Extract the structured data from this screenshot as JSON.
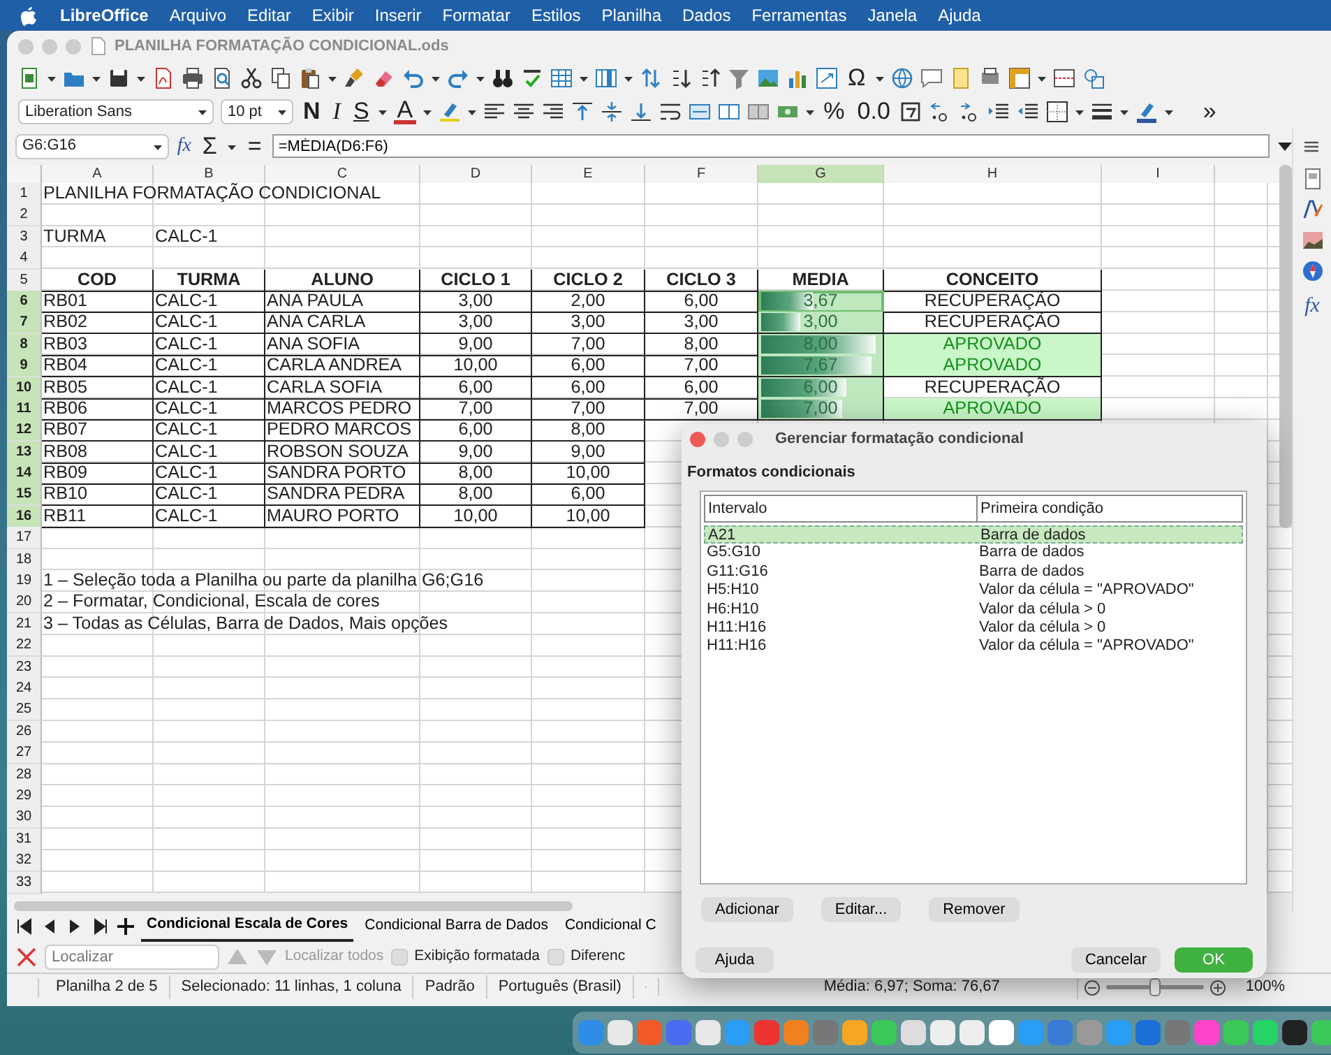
{
  "menu_bar": {
    "app_name": "LibreOffice",
    "items": [
      "Arquivo",
      "Editar",
      "Exibir",
      "Inserir",
      "Formatar",
      "Estilos",
      "Planilha",
      "Dados",
      "Ferramentas",
      "Janela",
      "Ajuda"
    ]
  },
  "window": {
    "title": "PLANILHA FORMATAÇÃO CONDICIONAL.ods"
  },
  "standard_toolbar": {
    "special_character": "Ω"
  },
  "formatting_toolbar": {
    "font_name": "Liberation Sans",
    "font_size": "10 pt",
    "style_buttons": [
      {
        "label": "N",
        "kind": "bold"
      },
      {
        "label": "I",
        "kind": "italic"
      },
      {
        "label": "S",
        "kind": "underline"
      }
    ],
    "font_color_label": "A",
    "percent_label": "%",
    "number_label": "0.0",
    "overflow_label": "»"
  },
  "formula_bar": {
    "name_box": "G6:G16",
    "function_wizard": "fx",
    "sum": "Σ",
    "equals": "=",
    "formula": "=MÉDIA(D6:F6)"
  },
  "sheet": {
    "columns": [
      {
        "label": "A",
        "selected": false
      },
      {
        "label": "B",
        "selected": false
      },
      {
        "label": "C",
        "selected": false
      },
      {
        "label": "D",
        "selected": false
      },
      {
        "label": "E",
        "selected": false
      },
      {
        "label": "F",
        "selected": false
      },
      {
        "label": "G",
        "selected": true
      },
      {
        "label": "H",
        "selected": false
      },
      {
        "label": "I",
        "selected": false
      }
    ],
    "rows": [
      {
        "number": "1",
        "selected": false,
        "kind": "plain",
        "cells": [
          {
            "kind": "title",
            "text": "PLANILHA FORMATAÇÃO CONDICIONAL"
          }
        ]
      },
      {
        "number": "2",
        "selected": false
      },
      {
        "number": "3",
        "selected": false,
        "kind": "plain",
        "cells": [
          {
            "kind": "text",
            "text": "TURMA"
          },
          {
            "kind": "text",
            "text": "CALC-1"
          }
        ]
      },
      {
        "number": "4",
        "selected": false
      },
      {
        "number": "5",
        "selected": false,
        "kind": "table",
        "cells": [
          {
            "kind": "header",
            "text": "COD"
          },
          {
            "kind": "header",
            "text": "TURMA"
          },
          {
            "kind": "header",
            "text": "ALUNO"
          },
          {
            "kind": "header",
            "text": "CICLO 1"
          },
          {
            "kind": "header",
            "text": "CICLO 2"
          },
          {
            "kind": "header",
            "text": "CICLO 3"
          },
          {
            "kind": "header",
            "text": "MEDIA"
          },
          {
            "kind": "header",
            "text": "CONCEITO"
          }
        ]
      },
      {
        "number": "6",
        "selected": true,
        "kind": "table",
        "cells": [
          {
            "kind": "text",
            "text": "RB01"
          },
          {
            "kind": "text",
            "text": "CALC-1"
          },
          {
            "kind": "text",
            "text": "ANA PAULA"
          },
          {
            "kind": "number",
            "text": "3,00"
          },
          {
            "kind": "number",
            "text": "2,00"
          },
          {
            "kind": "number",
            "text": "6,00"
          },
          {
            "kind": "bar",
            "text": "3,67",
            "level": 0.45,
            "active": true
          },
          {
            "kind": "status",
            "text": "RECUPERAÇÃO",
            "highlighted": false
          }
        ]
      },
      {
        "number": "7",
        "selected": true,
        "kind": "table",
        "cells": [
          {
            "kind": "text",
            "text": "RB02"
          },
          {
            "kind": "text",
            "text": "CALC-1"
          },
          {
            "kind": "text",
            "text": "ANA CARLA"
          },
          {
            "kind": "number",
            "text": "3,00"
          },
          {
            "kind": "number",
            "text": "3,00"
          },
          {
            "kind": "number",
            "text": "3,00"
          },
          {
            "kind": "bar",
            "text": "3,00",
            "level": 0.35,
            "active": false
          },
          {
            "kind": "status",
            "text": "RECUPERAÇÃO",
            "highlighted": false
          }
        ]
      },
      {
        "number": "8",
        "selected": true,
        "kind": "table",
        "cells": [
          {
            "kind": "text",
            "text": "RB03"
          },
          {
            "kind": "text",
            "text": "CALC-1"
          },
          {
            "kind": "text",
            "text": "ANA SOFIA"
          },
          {
            "kind": "number",
            "text": "9,00"
          },
          {
            "kind": "number",
            "text": "7,00"
          },
          {
            "kind": "number",
            "text": "8,00"
          },
          {
            "kind": "bar",
            "text": "8,00",
            "level": 0.95,
            "active": false
          },
          {
            "kind": "status",
            "text": "APROVADO",
            "highlighted": true
          }
        ]
      },
      {
        "number": "9",
        "selected": true,
        "kind": "table",
        "cells": [
          {
            "kind": "text",
            "text": "RB04"
          },
          {
            "kind": "text",
            "text": "CALC-1"
          },
          {
            "kind": "text",
            "text": "CARLA ANDREA"
          },
          {
            "kind": "number",
            "text": "10,00"
          },
          {
            "kind": "number",
            "text": "6,00"
          },
          {
            "kind": "number",
            "text": "7,00"
          },
          {
            "kind": "bar",
            "text": "7,67",
            "level": 0.92,
            "active": false
          },
          {
            "kind": "status",
            "text": "APROVADO",
            "highlighted": true
          }
        ]
      },
      {
        "number": "10",
        "selected": true,
        "kind": "table",
        "cells": [
          {
            "kind": "text",
            "text": "RB05"
          },
          {
            "kind": "text",
            "text": "CALC-1"
          },
          {
            "kind": "text",
            "text": "CARLA SOFIA"
          },
          {
            "kind": "number",
            "text": "6,00"
          },
          {
            "kind": "number",
            "text": "6,00"
          },
          {
            "kind": "number",
            "text": "6,00"
          },
          {
            "kind": "bar",
            "text": "6,00",
            "level": 0.72,
            "active": false
          },
          {
            "kind": "status",
            "text": "RECUPERAÇÃO",
            "highlighted": false
          }
        ]
      },
      {
        "number": "11",
        "selected": true,
        "kind": "table",
        "cells": [
          {
            "kind": "text",
            "text": "RB06"
          },
          {
            "kind": "text",
            "text": "CALC-1"
          },
          {
            "kind": "text",
            "text": "MARCOS PEDRO"
          },
          {
            "kind": "number",
            "text": "7,00"
          },
          {
            "kind": "number",
            "text": "7,00"
          },
          {
            "kind": "number",
            "text": "7,00"
          },
          {
            "kind": "bar",
            "text": "7,00",
            "level": 0.68,
            "active": false
          },
          {
            "kind": "status",
            "text": "APROVADO",
            "highlighted": true
          }
        ]
      },
      {
        "number": "12",
        "selected": true,
        "kind": "table",
        "cells": [
          {
            "kind": "text",
            "text": "RB07"
          },
          {
            "kind": "text",
            "text": "CALC-1"
          },
          {
            "kind": "text",
            "text": "PEDRO MARCOS"
          },
          {
            "kind": "number",
            "text": "6,00"
          },
          {
            "kind": "number",
            "text": "8,00"
          }
        ]
      },
      {
        "number": "13",
        "selected": true,
        "kind": "table",
        "cells": [
          {
            "kind": "text",
            "text": "RB08"
          },
          {
            "kind": "text",
            "text": "CALC-1"
          },
          {
            "kind": "text",
            "text": "ROBSON SOUZA"
          },
          {
            "kind": "number",
            "text": "9,00"
          },
          {
            "kind": "number",
            "text": "9,00"
          }
        ]
      },
      {
        "number": "14",
        "selected": true,
        "kind": "table",
        "cells": [
          {
            "kind": "text",
            "text": "RB09"
          },
          {
            "kind": "text",
            "text": "CALC-1"
          },
          {
            "kind": "text",
            "text": "SANDRA PORTO"
          },
          {
            "kind": "number",
            "text": "8,00"
          },
          {
            "kind": "number",
            "text": "10,00"
          }
        ]
      },
      {
        "number": "15",
        "selected": true,
        "kind": "table",
        "cells": [
          {
            "kind": "text",
            "text": "RB10"
          },
          {
            "kind": "text",
            "text": "CALC-1"
          },
          {
            "kind": "text",
            "text": "SANDRA PEDRA"
          },
          {
            "kind": "number",
            "text": "8,00"
          },
          {
            "kind": "number",
            "text": "6,00"
          }
        ]
      },
      {
        "number": "16",
        "selected": true,
        "kind": "table",
        "cells": [
          {
            "kind": "text",
            "text": "RB11"
          },
          {
            "kind": "text",
            "text": "CALC-1"
          },
          {
            "kind": "text",
            "text": "MAURO PORTO"
          },
          {
            "kind": "number",
            "text": "10,00"
          },
          {
            "kind": "number",
            "text": "10,00"
          }
        ]
      },
      {
        "number": "17",
        "selected": false
      },
      {
        "number": "18",
        "selected": false
      },
      {
        "number": "19",
        "selected": false,
        "kind": "plain",
        "cells": [
          {
            "kind": "note",
            "text": "1 – Seleção toda a Planilha ou parte da planilha G6;G16"
          }
        ]
      },
      {
        "number": "20",
        "selected": false,
        "kind": "plain",
        "cells": [
          {
            "kind": "note",
            "text": "2 – Formatar, Condicional, Escala de cores"
          }
        ]
      },
      {
        "number": "21",
        "selected": false,
        "kind": "plain",
        "cells": [
          {
            "kind": "note",
            "text": "3 – Todas as Células, Barra de Dados, Mais opções"
          }
        ]
      },
      {
        "number": "22",
        "selected": false
      },
      {
        "number": "23",
        "selected": false
      },
      {
        "number": "24",
        "selected": false
      },
      {
        "number": "25",
        "selected": false
      },
      {
        "number": "26",
        "selected": false
      },
      {
        "number": "27",
        "selected": false
      },
      {
        "number": "28",
        "selected": false
      },
      {
        "number": "29",
        "selected": false
      },
      {
        "number": "30",
        "selected": false
      },
      {
        "number": "31",
        "selected": false
      },
      {
        "number": "32",
        "selected": false
      },
      {
        "number": "33",
        "selected": false
      }
    ]
  },
  "sidebar": {
    "function_label": "fx"
  },
  "sheet_tabs": [
    {
      "label": "Condicional Escala de Cores",
      "selected": true
    },
    {
      "label": "Condicional Barra de Dados",
      "selected": false
    },
    {
      "label": "Condicional C",
      "selected": false
    }
  ],
  "find_bar": {
    "placeholder": "Localizar",
    "find_all": {
      "label": "Localizar todos",
      "disabled": true
    },
    "options": [
      {
        "label": "Exibição formatada",
        "checked": false
      },
      {
        "label": "Diferenc",
        "checked": false
      }
    ]
  },
  "status_bar": {
    "sheet": "Planilha 2 de 5",
    "selection": "Selecionado: 11 linhas, 1 coluna",
    "page_style": "Padrão",
    "language": "Português (Brasil)",
    "summary": "Média: 6,97; Soma: 76,67",
    "zoom": {
      "level": 0.5,
      "reading": "100%"
    }
  },
  "dialog": {
    "title": "Gerenciar formatação condicional",
    "section": "Formatos condicionais",
    "columns": [
      "Intervalo",
      "Primeira condição"
    ],
    "rows": [
      {
        "range": "A21",
        "condition": "Barra de dados",
        "selected": true
      },
      {
        "range": "G5:G10",
        "condition": "Barra de dados",
        "selected": false
      },
      {
        "range": "G11:G16",
        "condition": "Barra de dados",
        "selected": false
      },
      {
        "range": "H5:H10",
        "condition": "Valor da célula = \"APROVADO\"",
        "selected": false
      },
      {
        "range": "H6:H10",
        "condition": "Valor da célula > 0",
        "selected": false
      },
      {
        "range": "H11:H16",
        "condition": "Valor da célula > 0",
        "selected": false
      },
      {
        "range": "H11:H16",
        "condition": "Valor da célula = \"APROVADO\"",
        "selected": false
      }
    ],
    "list_buttons": [
      "Adicionar",
      "Editar...",
      "Remover"
    ],
    "footer_buttons": [
      {
        "label": "Ajuda",
        "kind": "help"
      },
      {
        "label": "Cancelar",
        "kind": "cancel"
      },
      {
        "label": "OK",
        "kind": "primary"
      }
    ]
  }
}
